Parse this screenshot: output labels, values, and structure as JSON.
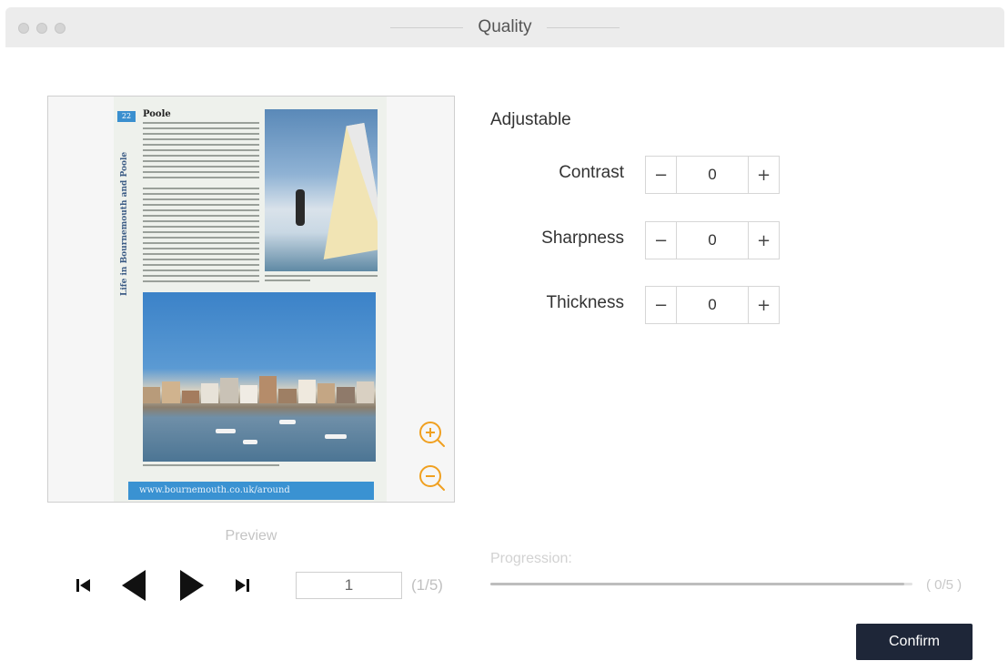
{
  "window": {
    "title": "Quality"
  },
  "preview": {
    "label": "Preview",
    "document": {
      "page_number": "22",
      "side_title": "Life in Bournemouth and Poole",
      "heading": "Poole",
      "footer_url": "www.bournemouth.co.uk/around"
    },
    "zoom_in_icon": "zoom-in-icon",
    "zoom_out_icon": "zoom-out-icon"
  },
  "navigation": {
    "first_icon": "skip-first-icon",
    "prev_icon": "previous-icon",
    "next_icon": "next-icon",
    "last_icon": "skip-last-icon",
    "current_page": "1",
    "total_label": "(1/5)"
  },
  "adjustable": {
    "title": "Adjustable",
    "rows": [
      {
        "label": "Contrast",
        "value": "0",
        "minus": "−",
        "plus": "+"
      },
      {
        "label": "Sharpness",
        "value": "0",
        "minus": "−",
        "plus": "+"
      },
      {
        "label": "Thickness",
        "value": "0",
        "minus": "−",
        "plus": "+"
      }
    ]
  },
  "progression": {
    "label": "Progression:",
    "count": "( 0/5 )",
    "progress": 0.98
  },
  "actions": {
    "confirm_label": "Confirm"
  },
  "colors": {
    "accent_orange": "#f0a020",
    "confirm_bg": "#1e2638",
    "nav_icon": "#111111"
  }
}
